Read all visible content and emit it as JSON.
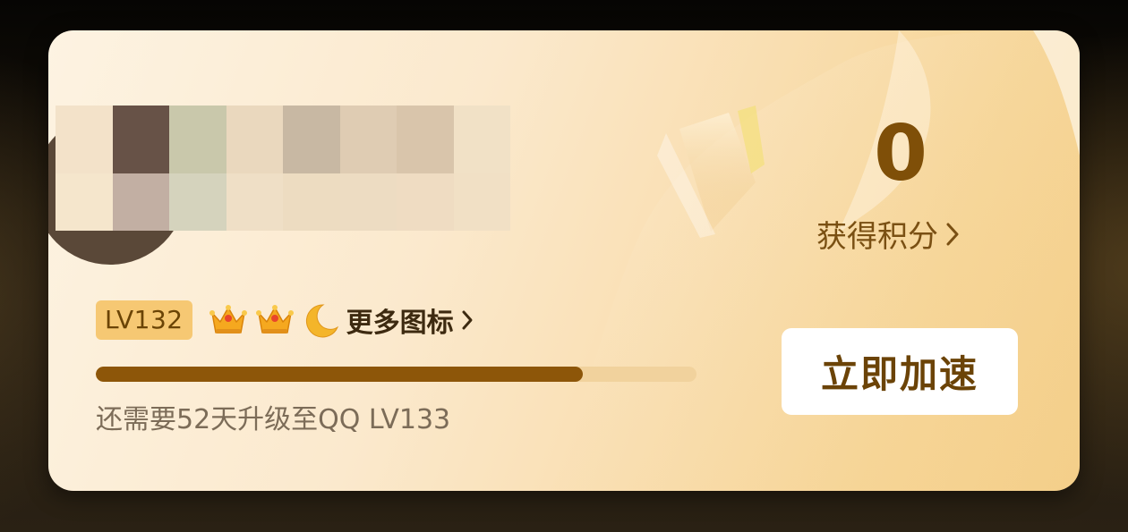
{
  "membership_card": {
    "level_badge": "LV132",
    "badge_icons": [
      "crown-icon",
      "crown-icon",
      "moon-icon"
    ],
    "more_icons_label": "更多图标",
    "progress": 0.81,
    "upgrade_hint": "还需要52天升级至QQ LV133",
    "points_value": "0",
    "points_label": "获得积分",
    "speed_up_label": "立即加速"
  },
  "colors": {
    "accent_brown": "#8d5609",
    "badge_bg": "#f6c873",
    "track": "#f1d29d",
    "button_text": "#6b4307"
  }
}
